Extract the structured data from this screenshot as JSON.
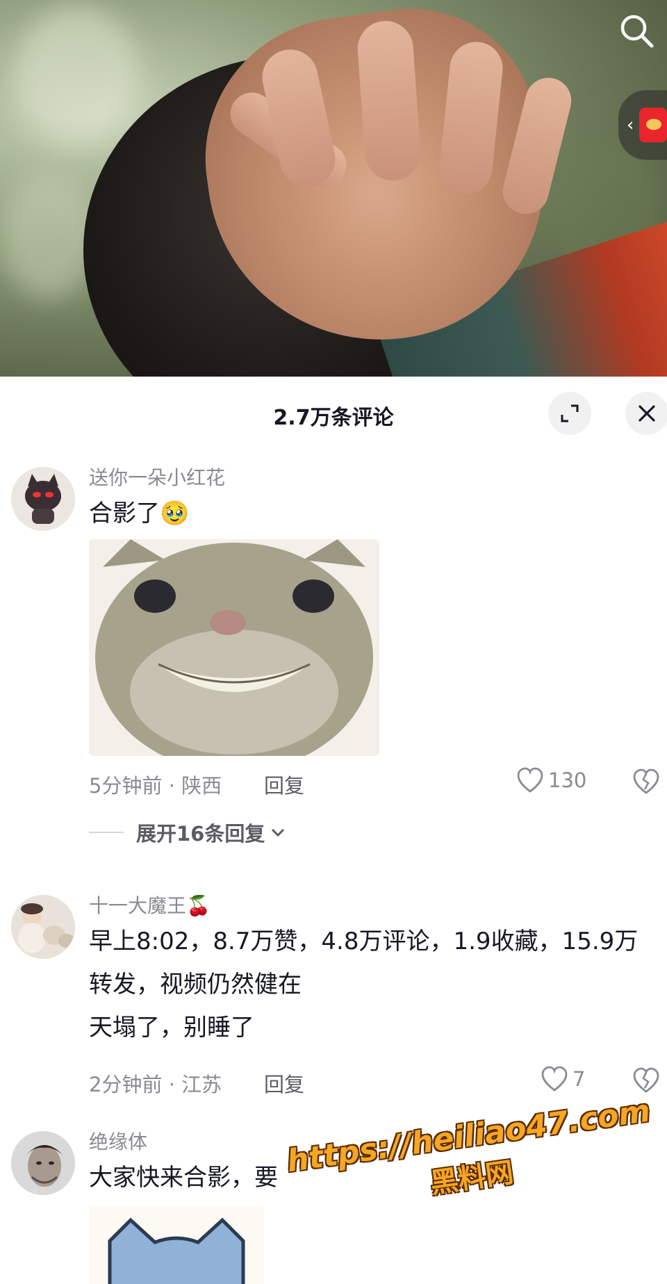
{
  "video": {
    "search_icon": "search-icon",
    "side_pill_icon": "red-envelope-icon"
  },
  "panel": {
    "title": "2.7万条评论",
    "expand_icon": "expand-icon",
    "close_icon": "close-icon"
  },
  "comments": [
    {
      "username": "送你一朵小红花",
      "text": "合影了",
      "emoji": "🥹",
      "time": "5分钟前 · 陕西",
      "reply_label": "回复",
      "likes": "130",
      "expand_label": "展开16条回复"
    },
    {
      "username": "十一大魔王",
      "badge_emoji": "🍒",
      "lines": [
        "早上8:02，8.7万赞，4.8万评论，1.9收藏，15.9万",
        "转发，视频仍然健在",
        "天塌了，别睡了"
      ],
      "time": "2分钟前 · 江苏",
      "reply_label": "回复",
      "likes": "7"
    },
    {
      "username": "绝缘体",
      "text": "大家快来合影，要"
    }
  ],
  "watermark": {
    "line1": "https://heiliao47.com",
    "line2": "黑料网"
  },
  "colors": {
    "accent_text": "#161823",
    "secondary_text": "#8a8b91",
    "watermark": "#f5a623"
  }
}
